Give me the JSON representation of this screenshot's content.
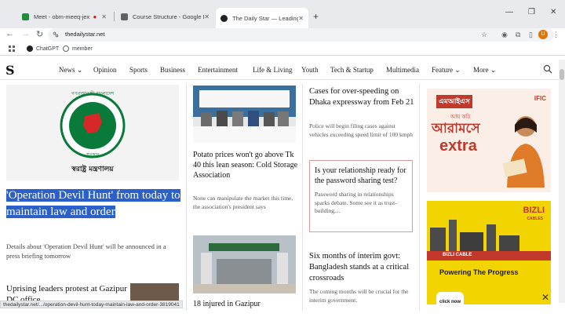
{
  "tabs": [
    {
      "title": "Meet - obm-meeq-jex",
      "fav_color": "#1e8e3e"
    },
    {
      "title": "Course Structure - Google Driv",
      "fav_color": "#5f6368"
    },
    {
      "title": "The Daily Star — Leading English",
      "fav_color": "#202124"
    }
  ],
  "toolbar": {
    "url": "thedailystar.net",
    "profile_initial": "U"
  },
  "bookmarks": [
    {
      "label": "ChatGPT"
    },
    {
      "label": "member"
    }
  ],
  "site": {
    "logo": "S",
    "nav": [
      "News",
      "Opinion",
      "Sports",
      "Business",
      "Entertainment",
      "Life & Living",
      "Youth",
      "Tech & Startup",
      "Multimedia",
      "Feature",
      "More"
    ]
  },
  "hero": {
    "emblem_text_top": "গণপ্রজাতন্ত্রী বাংলাদেশ",
    "emblem_text_bottom": "সরকার",
    "ministry": "স্বরাষ্ট্র মন্ত্রণালয়",
    "title": "'Operation Devil Hunt' from today to maintain law and order",
    "desc": "Details about 'Operation Devil Hunt' will be announced in a press briefing tomorrow"
  },
  "sub_story": {
    "title": "Uprising leaders protest at Gazipur DC office"
  },
  "articles": {
    "potato": {
      "title": "Potato prices won't go above Tk 40 this lean season: Cold Storage Association",
      "desc": "None can manipulate the market this time, the association's president says"
    },
    "gazipur": {
      "title": "18 injured in Gazipur"
    },
    "speeding": {
      "title": "Cases for over-speeding on Dhaka expressway from Feb 21",
      "desc": "Police will begin filing cases against vehicles exceeding speed limit of 100 kmph"
    },
    "quiz": {
      "title": "Is your relationship ready for the password sharing test?",
      "desc": "Password sharing in relationships sparks debate. Some see it as trust-building,..."
    },
    "interim": {
      "title": "Six months of interim govt: Bangladesh stands at a critical crossroads",
      "desc": "The coming months will be crucial for the interim government."
    }
  },
  "ads": {
    "ifc": {
      "brand": "IFIC",
      "top": "এমআইএস",
      "big1": "আরামসে",
      "big2": "extra",
      "small": "আয় করি"
    },
    "bizli": {
      "brand": "BIZLI",
      "sub": "CABLES",
      "cable": "BIZLI CABLE",
      "headline": "Powering The Progress",
      "cta": "click now"
    }
  },
  "status": {
    "link": "thedailystar.net/.../operation-devil-hunt-today-maintain-law-and-order-3819041"
  },
  "colors": {
    "highlight": "#2b5fc9",
    "emblem_green": "#0a7a3a",
    "emblem_red": "#d62828"
  }
}
